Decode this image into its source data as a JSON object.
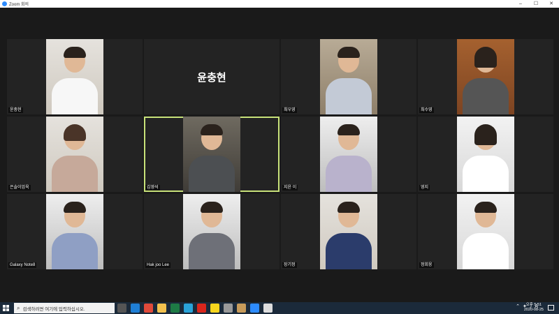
{
  "window": {
    "title": "Zoom 회의",
    "min": "–",
    "max": "☐",
    "close": "✕"
  },
  "gallery": {
    "tiles": [
      {
        "name": "윤충현"
      },
      {
        "name": "윤충현"
      },
      {
        "name": "최우영"
      },
      {
        "name": "최수영"
      },
      {
        "name": "은솔이엄욱"
      },
      {
        "name": "김영석"
      },
      {
        "name": "지윤 이"
      },
      {
        "name": "영지"
      },
      {
        "name": "Galaxy Note8"
      },
      {
        "name": "Hak joo Lee"
      },
      {
        "name": "장기정"
      },
      {
        "name": "정회웅"
      }
    ],
    "center_name": "윤충현"
  },
  "taskbar": {
    "search_placeholder": "검색하려면 여기에 입력하십시오.",
    "tray_ime": "A",
    "time": "오후 5:51",
    "date": "2020-08-25"
  },
  "colors": {
    "active_speaker_border": "#c8e27a",
    "zoom_blue": "#2d8cff",
    "taskbar": "#1b2a3a"
  }
}
